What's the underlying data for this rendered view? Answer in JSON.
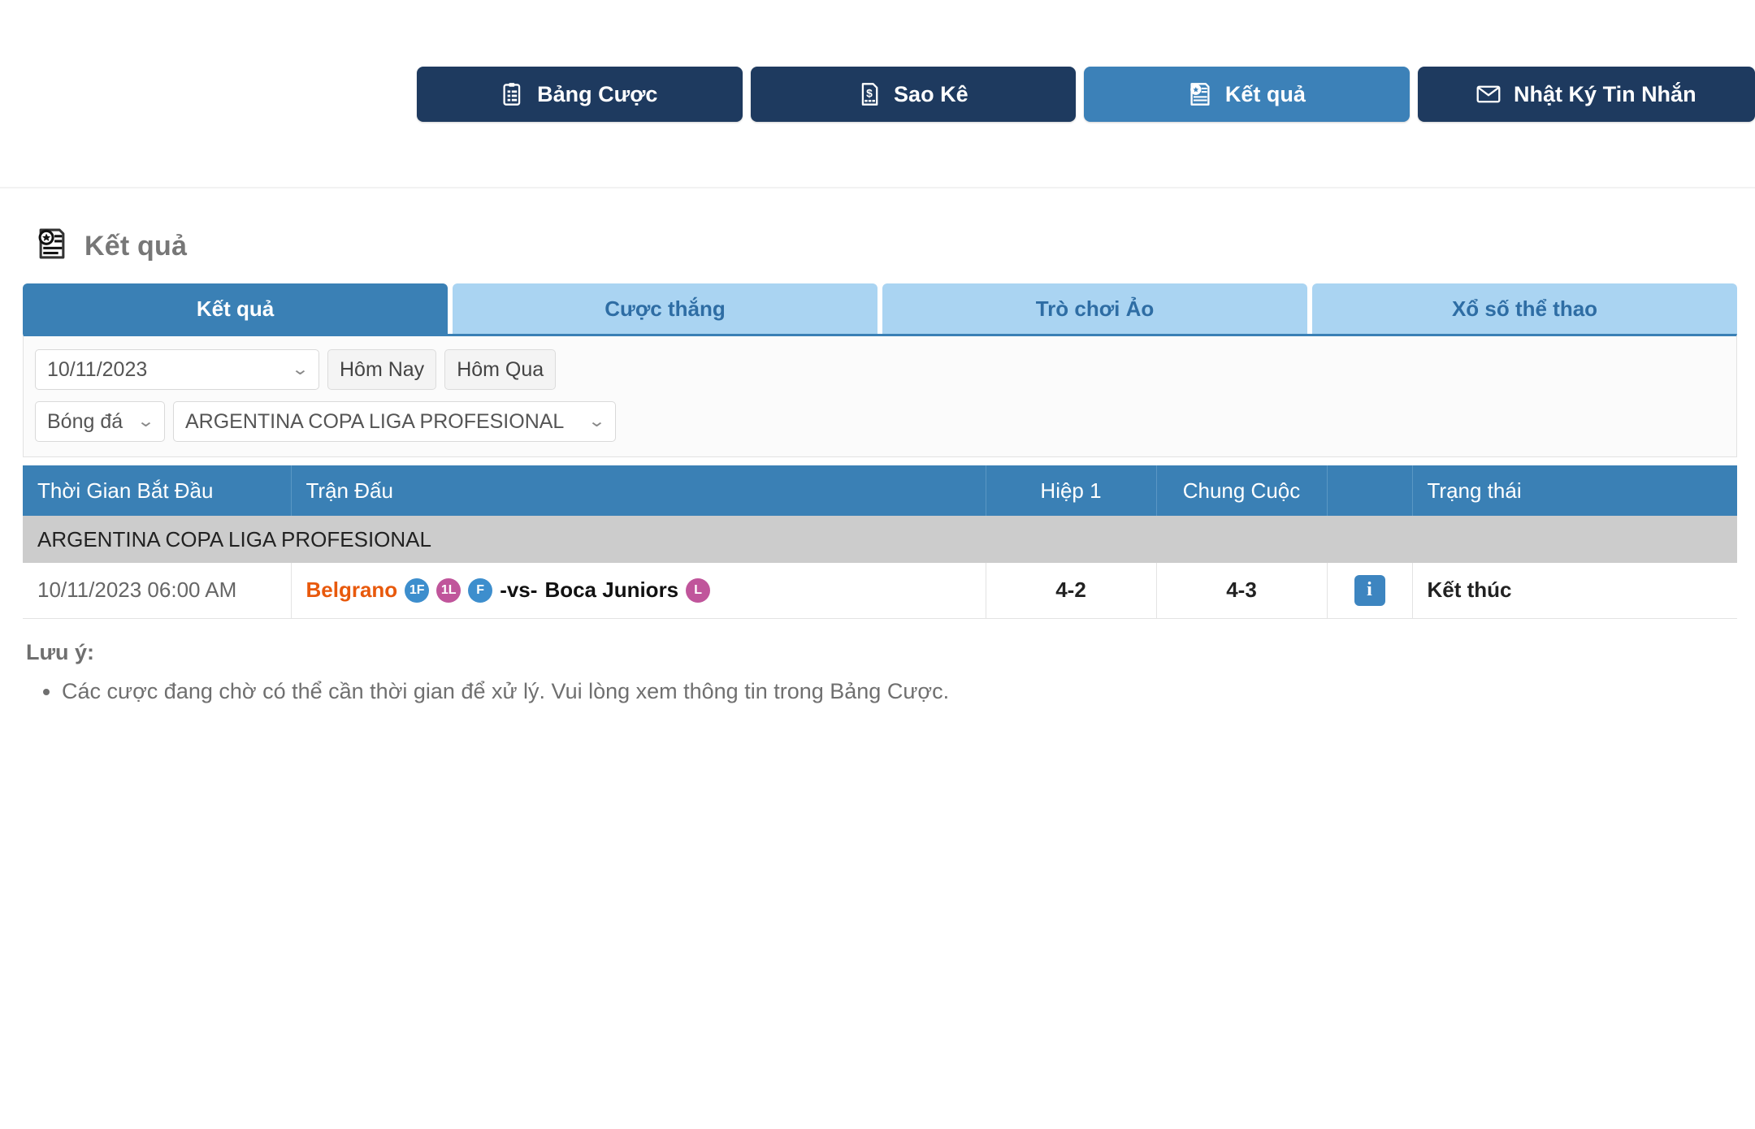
{
  "topnav": {
    "buttons": [
      {
        "label": "Bảng Cược",
        "icon": "clipboard-list-icon",
        "active": false
      },
      {
        "label": "Sao Kê",
        "icon": "invoice-dollar-icon",
        "active": false
      },
      {
        "label": "Kết quả",
        "icon": "results-star-icon",
        "active": true
      },
      {
        "label": "Nhật Ký Tin Nhắn",
        "icon": "envelope-icon",
        "active": false
      }
    ]
  },
  "page": {
    "title": "Kết quả",
    "title_icon": "results-star-icon"
  },
  "tabs": [
    {
      "label": "Kết quả",
      "active": true
    },
    {
      "label": "Cược thắng",
      "active": false
    },
    {
      "label": "Trò chơi Ảo",
      "active": false
    },
    {
      "label": "Xổ số thể thao",
      "active": false
    }
  ],
  "filters": {
    "date_value": "10/11/2023",
    "today_label": "Hôm Nay",
    "yesterday_label": "Hôm Qua",
    "sport_value": "Bóng đá",
    "league_value": "ARGENTINA COPA LIGA PROFESIONAL"
  },
  "table": {
    "headers": {
      "time": "Thời Gian Bắt Đầu",
      "match": "Trận Đấu",
      "half1": "Hiệp 1",
      "fulltime": "Chung Cuộc",
      "info": "",
      "status": "Trạng thái"
    },
    "league_group": "ARGENTINA COPA LIGA PROFESIONAL",
    "rows": [
      {
        "time": "10/11/2023 06:00 AM",
        "home_team": "Belgrano",
        "home_badges": [
          {
            "label": "1F",
            "color": "blue"
          },
          {
            "label": "1L",
            "color": "pink"
          },
          {
            "label": "F",
            "color": "blue"
          }
        ],
        "vs": "-vs-",
        "away_team": "Boca Juniors",
        "away_badges": [
          {
            "label": "L",
            "color": "pink"
          }
        ],
        "half1": "4-2",
        "fulltime": "4-3",
        "info_icon": "info-icon",
        "status": "Kết thúc"
      }
    ]
  },
  "notes": {
    "title": "Lưu ý:",
    "items": [
      "Các cược đang chờ có thể cần thời gian để xử lý. Vui lòng xem thông tin trong Bảng Cược."
    ]
  },
  "colors": {
    "navy": "#1e3a5f",
    "active_blue": "#3c81b8",
    "tab_light": "#aad4f2",
    "tab_text": "#2e6da4",
    "header_blue": "#3a80b5",
    "league_gray": "#cccccc",
    "home_orange": "#e8590c",
    "badge_blue": "#3d8ecd",
    "badge_pink": "#c0559b"
  }
}
